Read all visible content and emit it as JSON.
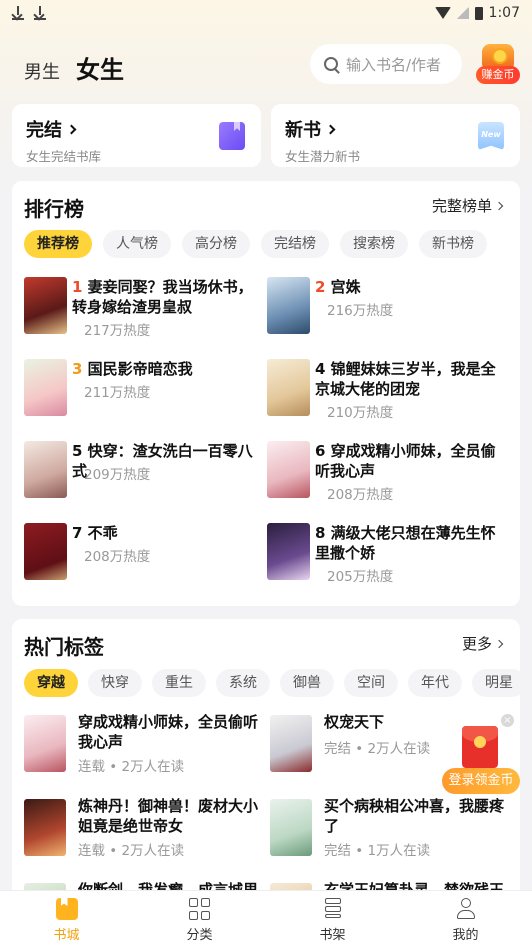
{
  "status": {
    "time": "1:07"
  },
  "header": {
    "gender_male": "男生",
    "gender_female": "女生",
    "search_placeholder": "输入书名/作者",
    "coin_label": "赚金币"
  },
  "quick_cards": [
    {
      "title": "完结",
      "subtitle": "女生完结书库"
    },
    {
      "title": "新书",
      "subtitle": "女生潜力新书",
      "badge": "New"
    }
  ],
  "ranking": {
    "title": "排行榜",
    "more": "完整榜单",
    "tabs": [
      "推荐榜",
      "人气榜",
      "高分榜",
      "完结榜",
      "搜索榜",
      "新书榜"
    ],
    "active_tab": 0,
    "items": [
      {
        "rank": "1",
        "title": "妻妾同娶？我当场休书，转身嫁给渣男皇叔",
        "heat": "217万热度"
      },
      {
        "rank": "2",
        "title": "宫姝",
        "heat": "216万热度"
      },
      {
        "rank": "3",
        "title": "国民影帝暗恋我",
        "heat": "211万热度"
      },
      {
        "rank": "4",
        "title": "锦鲤妹妹三岁半，我是全京城大佬的团宠",
        "heat": "210万热度"
      },
      {
        "rank": "5",
        "title": "快穿：渣女洗白一百零八式",
        "heat": "209万热度"
      },
      {
        "rank": "6",
        "title": "穿成戏精小师妹，全员偷听我心声",
        "heat": "208万热度"
      },
      {
        "rank": "7",
        "title": "不乖",
        "heat": "208万热度"
      },
      {
        "rank": "8",
        "title": "满级大佬只想在薄先生怀里撒个娇",
        "heat": "205万热度"
      }
    ]
  },
  "tags": {
    "title": "热门标签",
    "more": "更多",
    "chips": [
      "穿越",
      "快穿",
      "重生",
      "系统",
      "御兽",
      "空间",
      "年代",
      "明星"
    ],
    "active_chip": 0,
    "books": [
      {
        "title": "穿成戏精小师妹，全员偷听我心声",
        "meta": "连载 • 2万人在读"
      },
      {
        "title": "权宠天下",
        "meta": "完结 • 2万人在读"
      },
      {
        "title": "炼神丹！御神兽！废材大小姐竟是绝世帝女",
        "meta": "连载 • 2万人在读"
      },
      {
        "title": "买个病秧相公冲喜，我腰疼了",
        "meta": "完结 • 1万人在读"
      },
      {
        "title": "你断剑，我发癫，成言城里",
        "meta": ""
      },
      {
        "title": "玄学王妃算卦灵，禁欲残王",
        "meta": ""
      }
    ]
  },
  "promo": {
    "label": "登录领金币",
    "close": "×"
  },
  "nav": [
    {
      "label": "书城",
      "active": true
    },
    {
      "label": "分类"
    },
    {
      "label": "书架"
    },
    {
      "label": "我的"
    }
  ],
  "colors": {
    "accent": "#ffd43a",
    "rank_hot": "#f04b2a",
    "rank_third": "#f29a1a",
    "nav_active": "#f2a20c"
  }
}
